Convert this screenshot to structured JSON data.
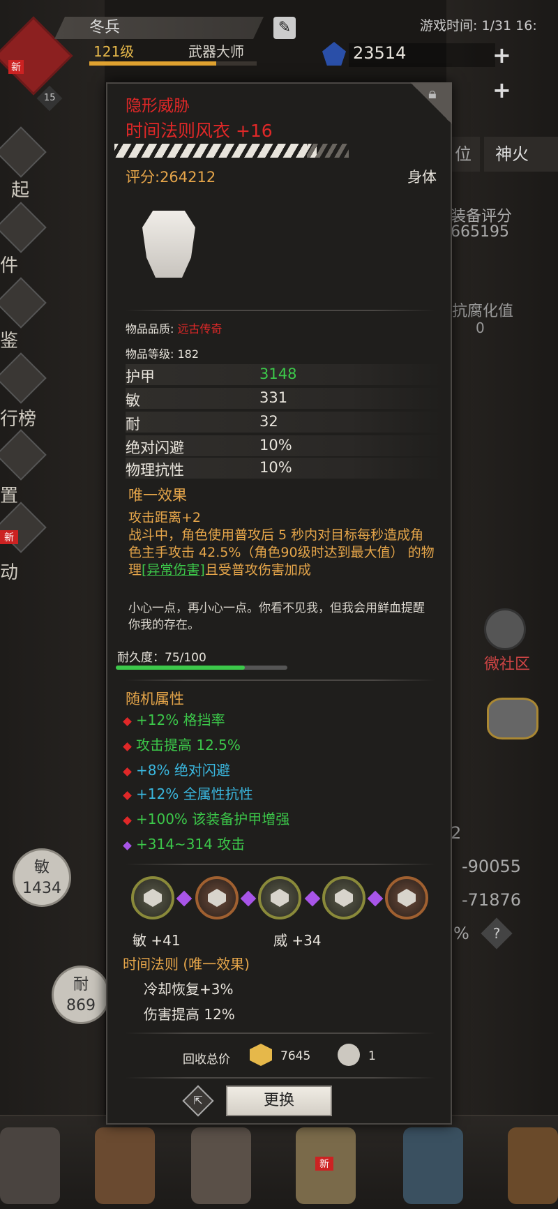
{
  "hud": {
    "avatar_new": "新",
    "avatar_level": "15",
    "player_name": "冬兵",
    "level": "121级",
    "title": "武器大师",
    "xp_fraction": 0.76,
    "gem_count": "23514",
    "game_time": "游戏时间: 1/31 16:"
  },
  "side_menu": [
    {
      "label": "起"
    },
    {
      "label": "件"
    },
    {
      "label": "鉴"
    },
    {
      "label": "行榜"
    },
    {
      "label": "置"
    },
    {
      "label": "动"
    }
  ],
  "side_new_badge": "新",
  "right_panel": {
    "tab_position": "位",
    "tab_fire": "神火",
    "equip_score_label": "装备评分",
    "equip_score_value": "665195",
    "resist_label": "抗腐化值",
    "resist_value": "0",
    "community_label": "微社区",
    "stat_0": "2",
    "stat_1": "-90055",
    "stat_2": "-71876",
    "stat_3": "%",
    "help": "?"
  },
  "left_circles": [
    {
      "label": "敏",
      "value": "1434"
    },
    {
      "label": "耐",
      "value": "869"
    }
  ],
  "bottom_new_badge": "新",
  "item": {
    "set_name": "隐形威胁",
    "name": "时间法则风衣 +16",
    "score": "评分:264212",
    "slot": "身体",
    "quality_label": "物品品质: ",
    "quality_value": "远古传奇",
    "level_label": "物品等级: 182",
    "stats": [
      {
        "name": "护甲",
        "value": "3148"
      },
      {
        "name": "敏",
        "value": "331"
      },
      {
        "name": "耐",
        "value": "32"
      },
      {
        "name": "绝对闪避",
        "value": "10%"
      },
      {
        "name": "物理抗性",
        "value": "10%"
      }
    ],
    "unique_title": "唯一效果",
    "unique_line1": "攻击距离+2",
    "unique_line2_pre": "战斗中，角色使用普攻后 5 秒内对目标每秒造成角色主手攻击 42.5%（角色90级时达到最大值） 的物理",
    "unique_link": "[异常伤害]",
    "unique_line2_post": "且受普攻伤害加成",
    "flavor": "小心一点，再小心一点。你看不见我，但我会用鲜血提醒你我的存在。",
    "durability_label": "耐久度：75/100",
    "durability_fraction": 0.75,
    "random_title": "随机属性",
    "random_attrs": [
      {
        "text": "+12% 格挡率",
        "color": "#3cc84a"
      },
      {
        "text": "攻击提高 12.5%",
        "color": "#3cc84a"
      },
      {
        "text": "+8% 绝对闪避",
        "color": "#3ab8e0"
      },
      {
        "text": "+12% 全属性抗性",
        "color": "#3ab8e0"
      },
      {
        "text": "+100% 该装备护甲增强",
        "color": "#3cc84a"
      },
      {
        "text": "+314~314 攻击",
        "color": "#3cc84a"
      }
    ],
    "rune_stat_1": "敏 +41",
    "rune_stat_2": "威 +34",
    "rune_set_title": "时间法则 (唯一效果)",
    "rune_effects": [
      "冷却恢复+3%",
      "伤害提高 12%"
    ],
    "recycle_label": "回收总价",
    "recycle_coins": "7645",
    "recycle_material": "1",
    "replace_button": "更换",
    "share_icon": "⇱"
  }
}
